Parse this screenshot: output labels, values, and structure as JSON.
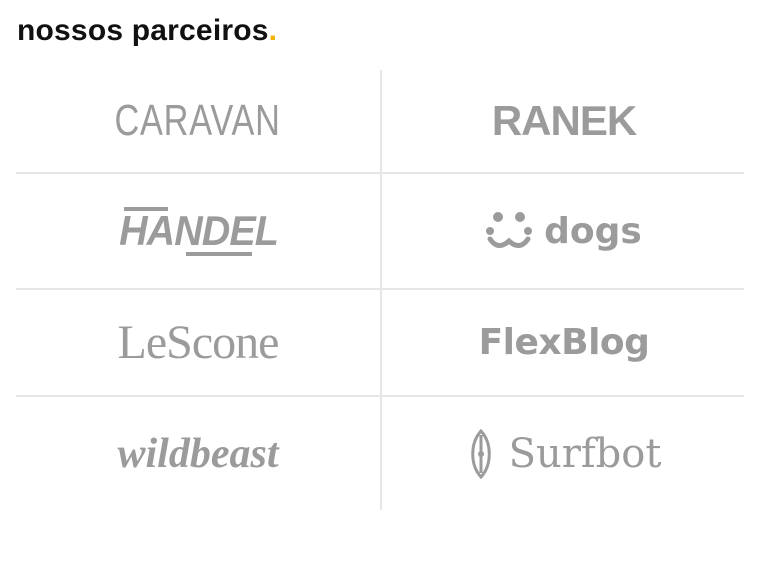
{
  "section": {
    "title": "nossos parceiros",
    "title_dot": ".",
    "accent_color": "#f5b400"
  },
  "partners": [
    {
      "name": "CARAVAN",
      "icon": null
    },
    {
      "name": "RANEK",
      "icon": null
    },
    {
      "name": "HANDEL",
      "icon": null
    },
    {
      "name": "dogs",
      "icon": "dog-face-icon"
    },
    {
      "name": "LeScone",
      "icon": null
    },
    {
      "name": "FlexBlog",
      "icon": null
    },
    {
      "name": "wildbeast",
      "icon": null
    },
    {
      "name": "Surfbot",
      "icon": "surfboard-icon"
    }
  ],
  "colors": {
    "logo": "#9b9b9b",
    "divider": "#e6e6e6"
  }
}
